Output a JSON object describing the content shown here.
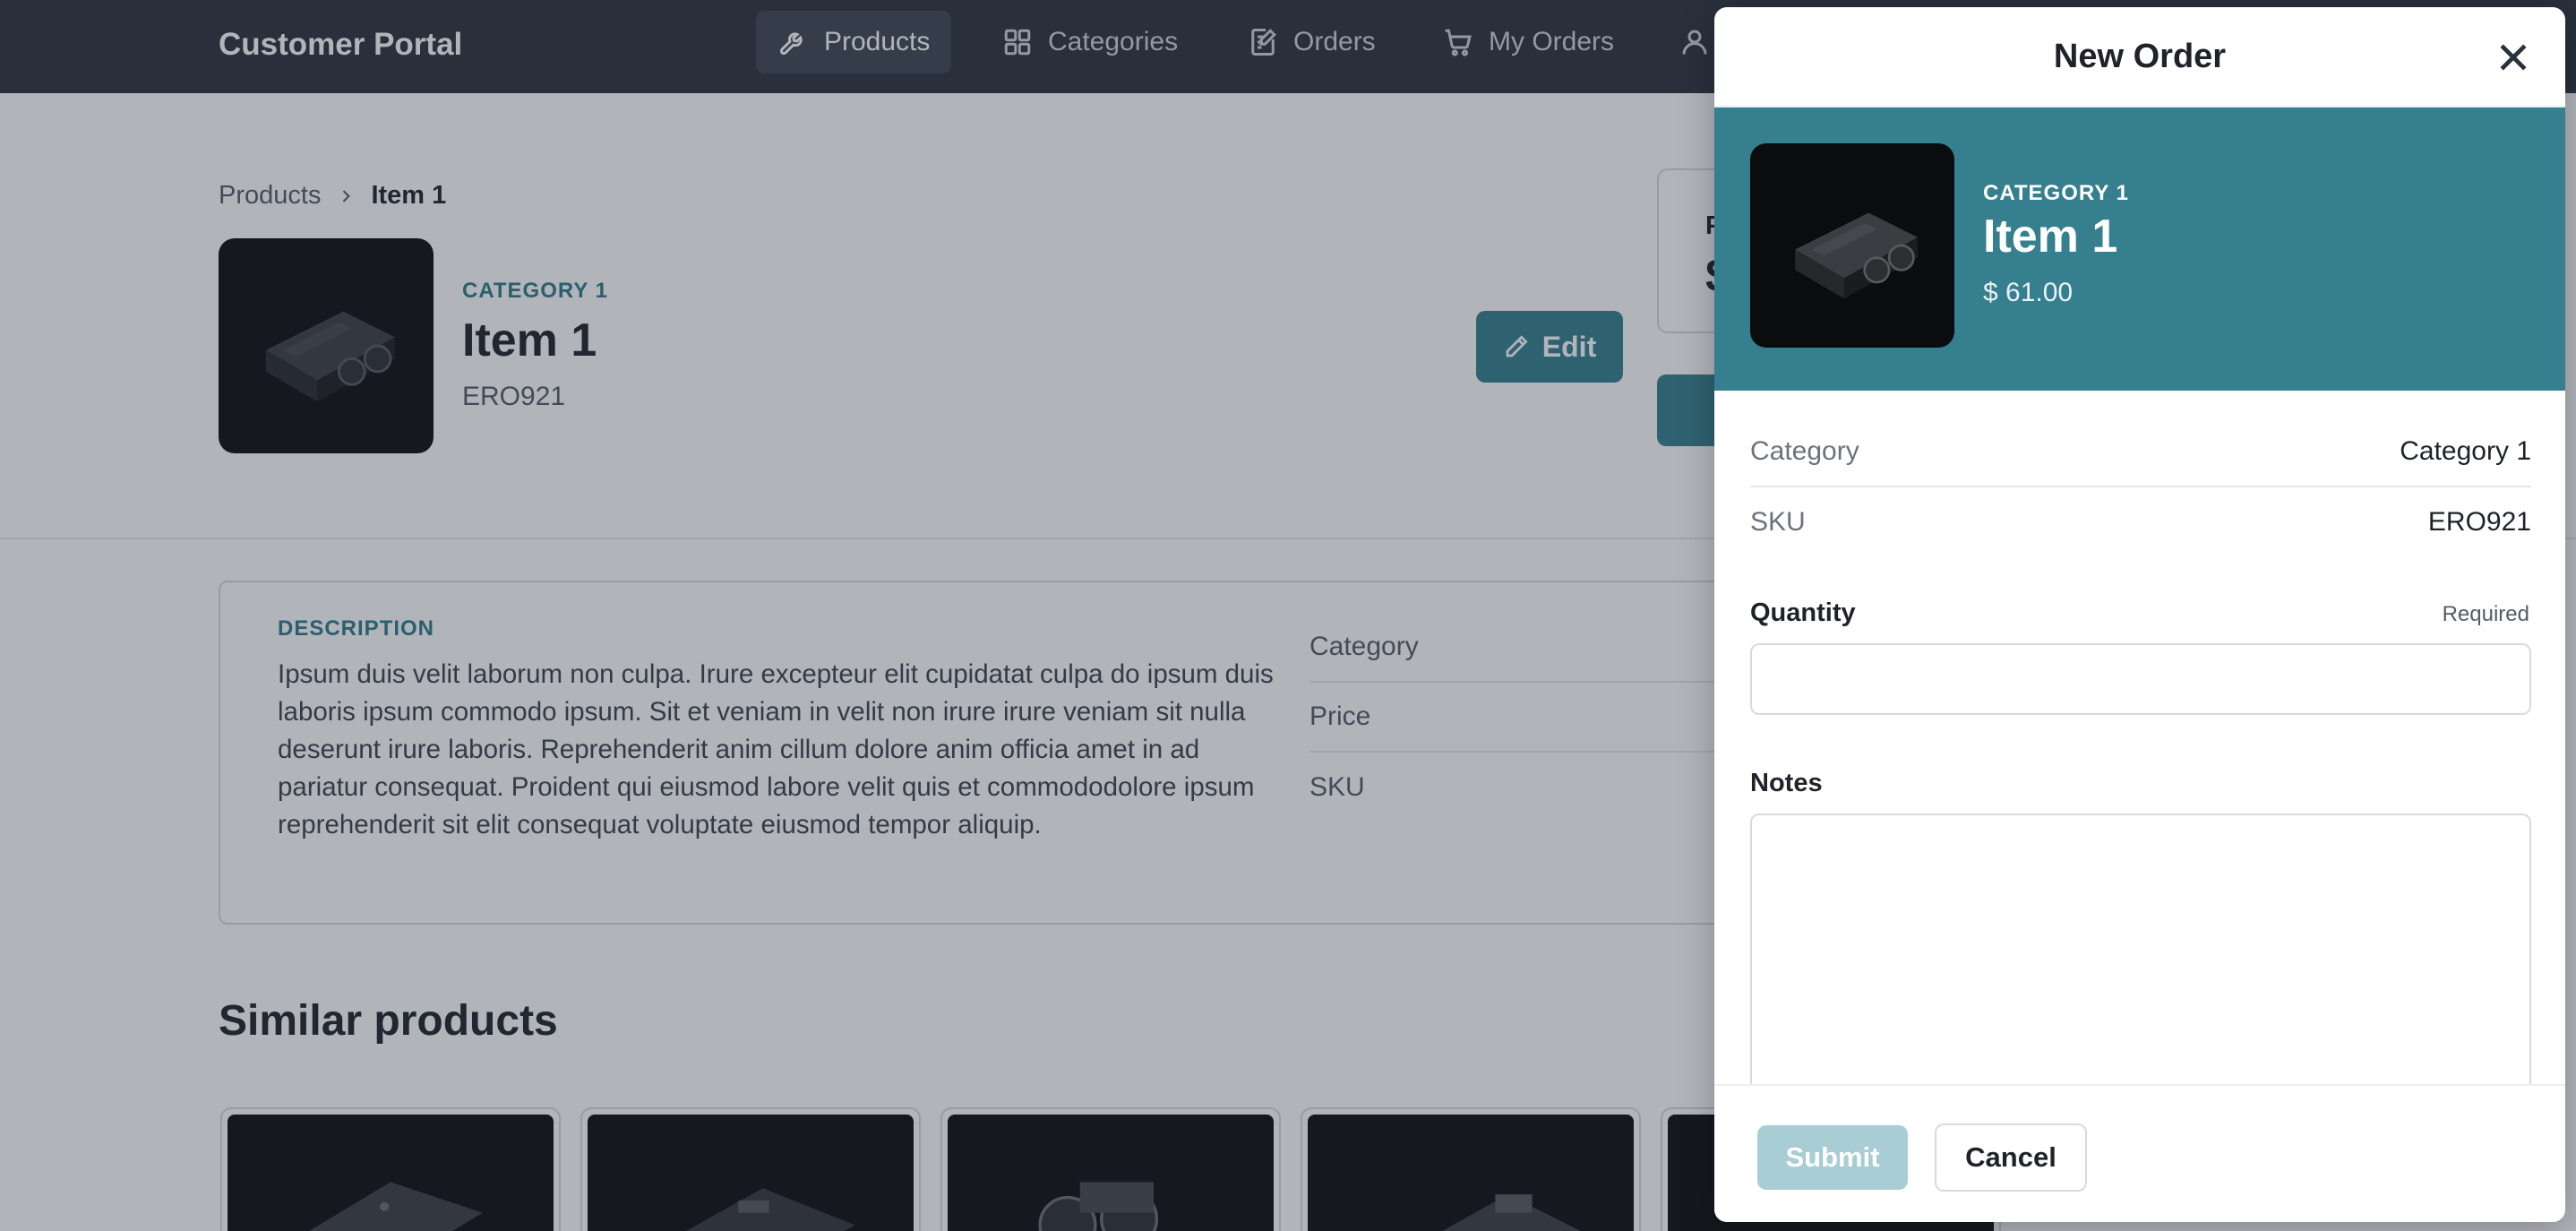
{
  "app": {
    "title": "Customer Portal"
  },
  "nav": {
    "items": [
      {
        "label": "Products",
        "icon": "wrench-icon",
        "active": true
      },
      {
        "label": "Categories",
        "icon": "grid-icon",
        "active": false
      },
      {
        "label": "Orders",
        "icon": "document-edit-icon",
        "active": false
      },
      {
        "label": "My Orders",
        "icon": "cart-icon",
        "active": false
      }
    ],
    "more_icon": "user-icon"
  },
  "breadcrumb": {
    "root": "Products",
    "current": "Item 1"
  },
  "product": {
    "category": "CATEGORY 1",
    "name": "Item 1",
    "sku": "ERO921",
    "edit_label": "Edit",
    "price_label_partial": "P",
    "price_value_partial": "$"
  },
  "description": {
    "title": "DESCRIPTION",
    "text": "Ipsum duis velit laborum non culpa. Irure excepteur elit cupidatat culpa do ipsum duis laboris ipsum commodo ipsum. Sit et veniam in velit non irure irure veniam sit nulla deserunt irure laboris. Reprehenderit anim cillum dolore anim officia amet in ad pariatur consequat. Proident qui eiusmod labore velit quis et commododolore ipsum reprehenderit sit elit consequat voluptate eiusmod tempor aliquip.",
    "specs": [
      "Category",
      "Price",
      "SKU"
    ]
  },
  "similar": {
    "title": "Similar products",
    "count_visible": 5
  },
  "drawer": {
    "title": "New Order",
    "close_icon": "close-icon",
    "banner": {
      "category": "CATEGORY 1",
      "name": "Item 1",
      "price": "$ 61.00"
    },
    "details": [
      {
        "key": "Category",
        "value": "Category 1"
      },
      {
        "key": "SKU",
        "value": "ERO921"
      }
    ],
    "quantity": {
      "label": "Quantity",
      "required": "Required",
      "value": "",
      "placeholder": ""
    },
    "notes": {
      "label": "Notes",
      "value": "",
      "placeholder": ""
    },
    "submit_label": "Submit",
    "cancel_label": "Cancel"
  },
  "colors": {
    "accent": "#357f8e",
    "topbar": "#2b313c",
    "submit_disabled": "#a9cdd4"
  }
}
